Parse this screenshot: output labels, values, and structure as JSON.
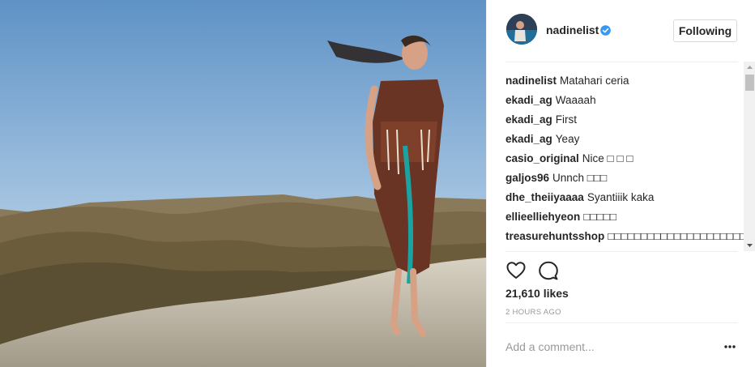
{
  "header": {
    "username": "nadinelist",
    "follow_label": "Following"
  },
  "comments": [
    {
      "user": "nadinelist",
      "text": "Matahari ceria"
    },
    {
      "user": "ekadi_ag",
      "text": "Waaaah"
    },
    {
      "user": "ekadi_ag",
      "text": "First"
    },
    {
      "user": "ekadi_ag",
      "text": "Yeay"
    },
    {
      "user": "casio_original",
      "text": "Nice □ □ □"
    },
    {
      "user": "galjos96",
      "text": "Unnch □□□"
    },
    {
      "user": "dhe_theiiyaaaa",
      "text": "Syantiiik kaka"
    },
    {
      "user": "ellieelliehyeon",
      "text": "□□□□□"
    },
    {
      "user": "treasurehuntsshop",
      "text": "□□□□□□□□□□□□□□□□□□□□□□□□□□□□□□□□□□□□"
    }
  ],
  "likes": "21,610 likes",
  "time": "2 HOURS AGO",
  "comment_placeholder": "Add a comment...",
  "icons": {
    "like": "heart-outline-icon",
    "comment": "speech-bubble-icon",
    "verified": "verified-badge-icon",
    "more": "ellipsis-icon"
  },
  "colors": {
    "verified": "#3897f0",
    "text": "#262626",
    "muted": "#999999",
    "border": "#efefef"
  }
}
